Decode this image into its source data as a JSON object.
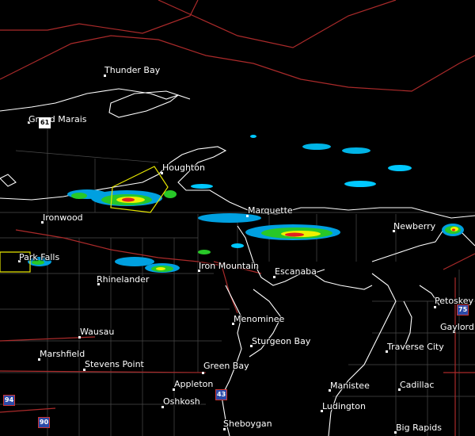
{
  "cities": [
    {
      "id": "thunder-bay",
      "name": "Thunder Bay"
    },
    {
      "id": "grand-marais",
      "name": "Grand Marais"
    },
    {
      "id": "houghton",
      "name": "Houghton"
    },
    {
      "id": "ironwood",
      "name": "Ironwood"
    },
    {
      "id": "marquette",
      "name": "Marquette"
    },
    {
      "id": "newberry",
      "name": "Newberry"
    },
    {
      "id": "park-falls",
      "name": "Park Falls"
    },
    {
      "id": "iron-mountain",
      "name": "Iron Mountain"
    },
    {
      "id": "rhinelander",
      "name": "Rhinelander"
    },
    {
      "id": "escanaba",
      "name": "Escanaba"
    },
    {
      "id": "petoskey",
      "name": "Petoskey"
    },
    {
      "id": "menominee",
      "name": "Menominee"
    },
    {
      "id": "gaylord",
      "name": "Gaylord"
    },
    {
      "id": "wausau",
      "name": "Wausau"
    },
    {
      "id": "sturgeon-bay",
      "name": "Sturgeon Bay"
    },
    {
      "id": "traverse-city",
      "name": "Traverse City"
    },
    {
      "id": "marshfield",
      "name": "Marshfield"
    },
    {
      "id": "stevens-point",
      "name": "Stevens Point"
    },
    {
      "id": "green-bay",
      "name": "Green Bay"
    },
    {
      "id": "appleton",
      "name": "Appleton"
    },
    {
      "id": "manistee",
      "name": "Manistee"
    },
    {
      "id": "cadillac",
      "name": "Cadillac"
    },
    {
      "id": "oshkosh",
      "name": "Oshkosh"
    },
    {
      "id": "ludington",
      "name": "Ludington"
    },
    {
      "id": "sheboygan",
      "name": "Sheboygan"
    },
    {
      "id": "big-rapids",
      "name": "Big Rapids"
    }
  ],
  "shields": [
    {
      "id": "hwy-61",
      "label": "61",
      "kind": "us"
    },
    {
      "id": "i-75",
      "label": "75",
      "kind": "interstate"
    },
    {
      "id": "i-43",
      "label": "43",
      "kind": "interstate"
    },
    {
      "id": "i-94",
      "label": "94",
      "kind": "interstate"
    },
    {
      "id": "i-90",
      "label": "90",
      "kind": "interstate"
    }
  ],
  "colors": {
    "background": "#000000",
    "state_borders": "#cc3333",
    "county_lines": "#555555",
    "shoreline": "#ffffff",
    "warning_polygon": "#e6e600",
    "radar_light": "#00c8ff",
    "radar_med": "#00a0e0",
    "radar_green": "#28c828",
    "radar_yellow": "#f0f000",
    "radar_red": "#e02020"
  }
}
